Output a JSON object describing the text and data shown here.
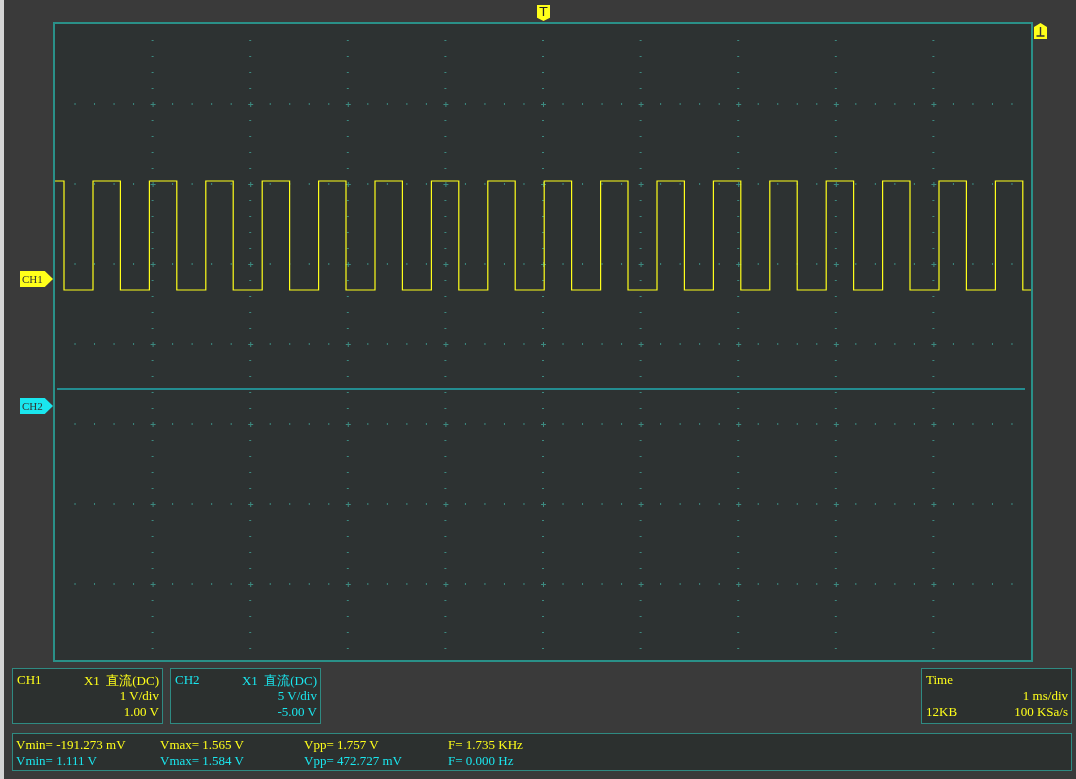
{
  "trigger_marker": "T",
  "channel_markers": [
    {
      "label": "CH1",
      "color": "#ffff1a"
    },
    {
      "label": "CH2",
      "color": "#1ae6ee"
    }
  ],
  "channels": [
    {
      "name": "CH1",
      "probe": "X1",
      "coupling": "直流(DC)",
      "scale": "1 V/div",
      "offset": "1.00 V",
      "color": "#ffff1a"
    },
    {
      "name": "CH2",
      "probe": "X1",
      "coupling": "直流(DC)",
      "scale": "5 V/div",
      "offset": "-5.00 V",
      "color": "#1ae6ee"
    }
  ],
  "timebase": {
    "title": "Time",
    "scale": "1 ms/div",
    "memory": "12KB",
    "sample_rate": "100 KSa/s"
  },
  "measurements": [
    {
      "vmin": "Vmin= -191.273 mV",
      "vmax": "Vmax= 1.565 V",
      "vpp": "Vpp= 1.757 V",
      "freq": "F= 1.735 KHz",
      "color": "#ffff1a"
    },
    {
      "vmin": "Vmin= 1.111 V",
      "vmax": "Vmax= 1.584 V",
      "vpp": "Vpp= 472.727 mV",
      "freq": "F= 0.000 Hz",
      "color": "#1ae6ee"
    }
  ]
}
